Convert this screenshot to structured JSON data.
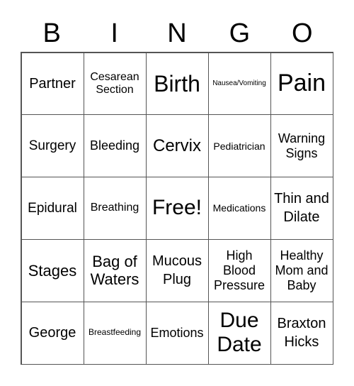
{
  "header": [
    "B",
    "I",
    "N",
    "G",
    "O"
  ],
  "cells": [
    "Partner",
    "Cesarean Section",
    "Birth",
    "Nausea/Vomiting",
    "Pain",
    "Surgery",
    "Bleeding",
    "Cervix",
    "Pediatrician",
    "Warning Signs",
    "Epidural",
    "Breathing",
    "Free!",
    "Medications",
    "Thin and Dilate",
    "Stages",
    "Bag of Waters",
    "Mucous Plug",
    "High Blood Pressure",
    "Healthy Mom and Baby",
    "George",
    "Breastfeeding",
    "Emotions",
    "Due Date",
    "Braxton Hicks"
  ]
}
